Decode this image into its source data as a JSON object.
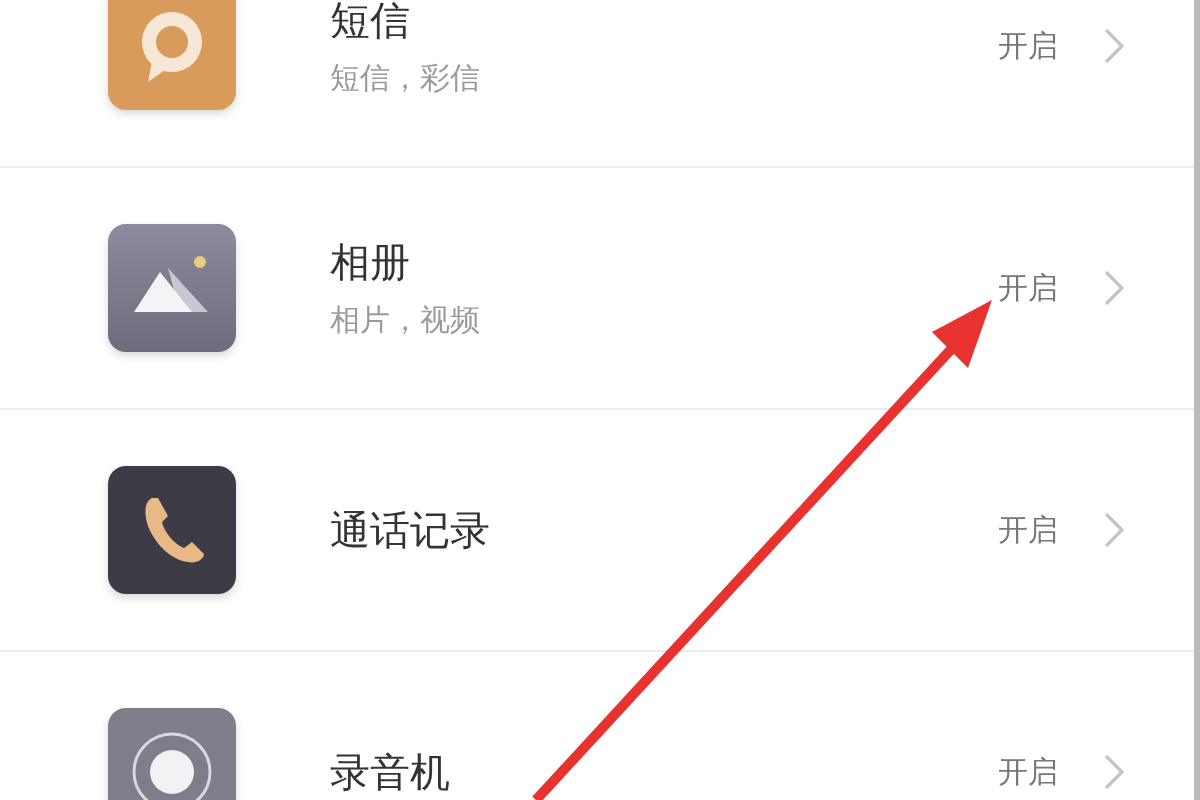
{
  "apps": [
    {
      "kind": "messages",
      "title": "短信",
      "subtitle": "短信，彩信",
      "status": "开启"
    },
    {
      "kind": "gallery",
      "title": "相册",
      "subtitle": "相片，视频",
      "status": "开启"
    },
    {
      "kind": "calls",
      "title": "通话记录",
      "status": "开启"
    },
    {
      "kind": "recorder",
      "title": "录音机",
      "status": "开启"
    }
  ]
}
